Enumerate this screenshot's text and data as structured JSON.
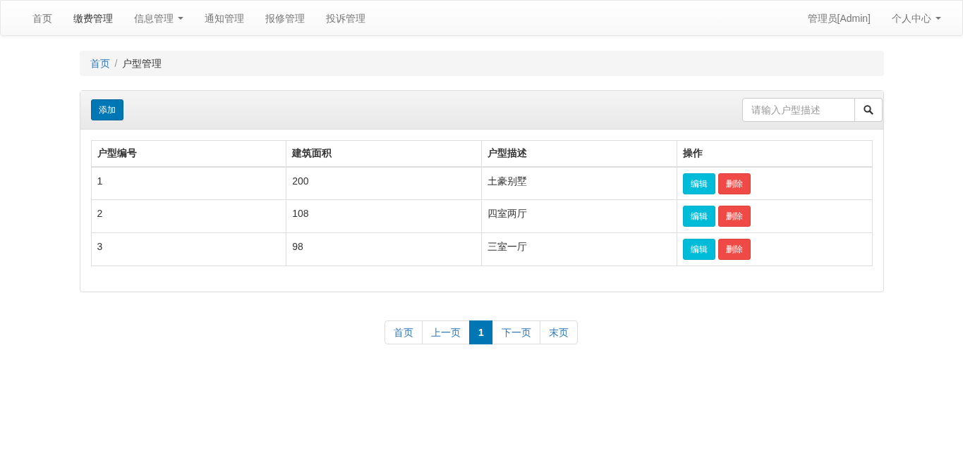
{
  "navbar": {
    "items": [
      {
        "label": "首页",
        "selected": false,
        "has_menu": false
      },
      {
        "label": "缴费管理",
        "selected": true,
        "has_menu": false
      },
      {
        "label": "信息管理",
        "selected": false,
        "has_menu": true
      },
      {
        "label": "通知管理",
        "selected": false,
        "has_menu": false
      },
      {
        "label": "报修管理",
        "selected": false,
        "has_menu": false
      },
      {
        "label": "投诉管理",
        "selected": false,
        "has_menu": false
      }
    ],
    "right_items": [
      {
        "label": "管理员[Admin]",
        "has_menu": false
      },
      {
        "label": "个人中心",
        "has_menu": true
      }
    ]
  },
  "breadcrumb_separator": "/",
  "breadcrumb": [
    {
      "label": "首页",
      "kind": "link"
    },
    {
      "label": "户型管理",
      "kind": "current"
    }
  ],
  "panel": {
    "add_button": "添加",
    "search": {
      "placeholder": "请输入户型描述"
    },
    "table": {
      "columns": [
        "户型编号",
        "建筑面积",
        "户型描述",
        "操作"
      ],
      "rows": [
        {
          "cells": [
            "1",
            "200",
            "土豪别墅"
          ],
          "actions": [
            "编辑",
            "删除"
          ]
        },
        {
          "cells": [
            "2",
            "108",
            "四室两厅"
          ],
          "actions": [
            "编辑",
            "删除"
          ]
        },
        {
          "cells": [
            "3",
            "98",
            "三室一厅"
          ],
          "actions": [
            "编辑",
            "删除"
          ]
        }
      ]
    }
  },
  "pagination": [
    {
      "label": "首页",
      "selected": false
    },
    {
      "label": "上一页",
      "selected": false
    },
    {
      "label": "1",
      "selected": true
    },
    {
      "label": "下一页",
      "selected": false
    },
    {
      "label": "末页",
      "selected": false
    }
  ]
}
